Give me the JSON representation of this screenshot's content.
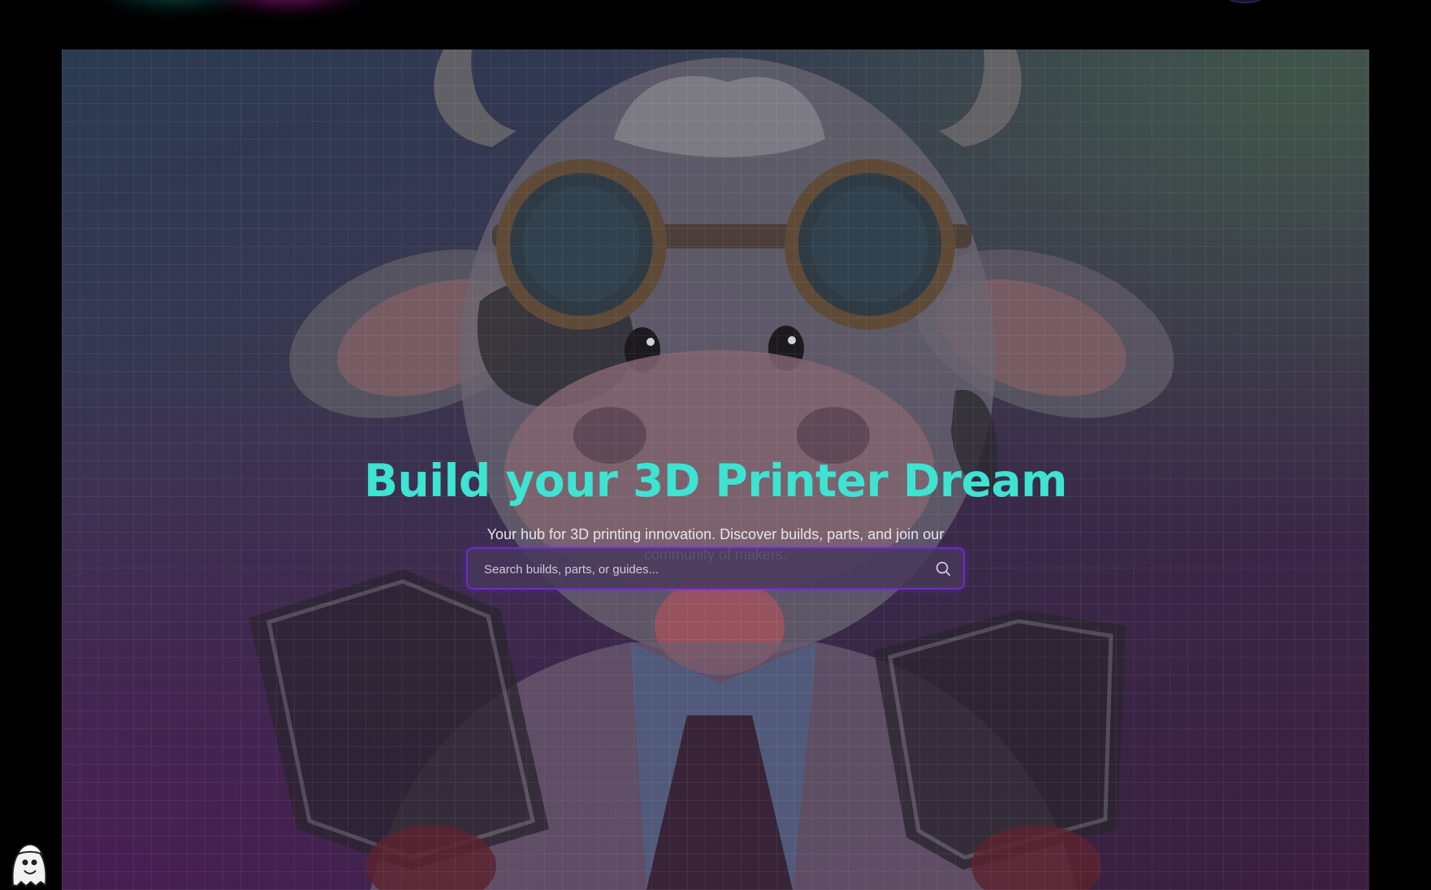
{
  "hero": {
    "title": "Build your 3D Printer Dream",
    "subtitle": "Your hub for 3D printing innovation. Discover builds, parts, and join our community of makers.",
    "title_color": "#3ee3d2"
  },
  "search": {
    "placeholder": "Search builds, parts, or guides...",
    "value": "",
    "border_color": "#6c2bd0",
    "icon": "search-icon"
  },
  "decor": {
    "hero_image": "cow-with-goggles-and-3d-printers",
    "corner_badge": "ghost-mascot-icon"
  }
}
